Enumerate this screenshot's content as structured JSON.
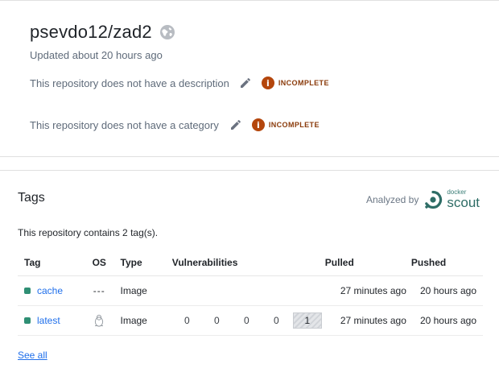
{
  "repo": {
    "title": "psevdo12/zad2",
    "updated": "Updated about 20 hours ago",
    "description_text": "This repository does not have a description",
    "category_text": "This repository does not have a category",
    "status_label": "INCOMPLETE",
    "status_color": "#b4460c"
  },
  "tags_section": {
    "heading": "Tags",
    "analyzed_by": "Analyzed by",
    "scout_brand_small": "docker",
    "scout_brand_word": "scout",
    "contains_text": "This repository contains 2 tag(s).",
    "columns": {
      "tag": "Tag",
      "os": "OS",
      "type": "Type",
      "vulnerabilities": "Vulnerabilities",
      "pulled": "Pulled",
      "pushed": "Pushed"
    },
    "rows": [
      {
        "tag": "cache",
        "os": "---",
        "os_icon": "none",
        "type": "Image",
        "vulnerabilities": [],
        "unspecified": "",
        "pulled": "27 minutes ago",
        "pushed": "20 hours ago"
      },
      {
        "tag": "latest",
        "os": "",
        "os_icon": "linux-tux-icon",
        "type": "Image",
        "vulnerabilities": [
          "0",
          "0",
          "0",
          "0"
        ],
        "unspecified": "1",
        "pulled": "27 minutes ago",
        "pushed": "20 hours ago"
      }
    ],
    "see_all": "See all",
    "accent_color": "#2f8f74",
    "link_color": "#1f6feb"
  }
}
